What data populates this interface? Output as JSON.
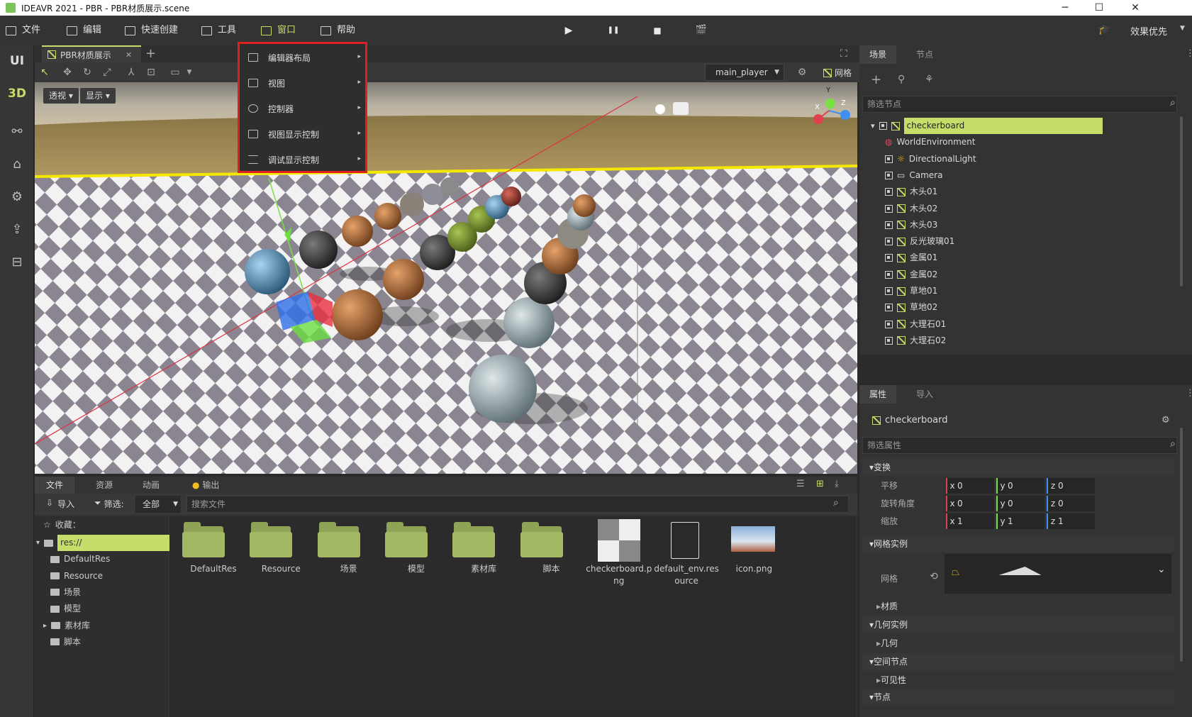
{
  "window": {
    "title": "IDEAVR 2021 - PBR - PBR材质展示.scene",
    "minimize": "─",
    "maximize": "☐",
    "close": "✕"
  },
  "menubar": {
    "items": [
      {
        "label": "文件"
      },
      {
        "label": "编辑"
      },
      {
        "label": "快速创建"
      },
      {
        "label": "工具"
      },
      {
        "label": "窗口"
      },
      {
        "label": "帮助"
      }
    ],
    "play": "▶",
    "pause": "❚❚",
    "stop": "■",
    "movie": "🎬",
    "quality_label": "效果优先"
  },
  "lefttool": {
    "ui": "UI",
    "three_d": "3D"
  },
  "viewport": {
    "tab_label": "PBR材质展示",
    "tab_close": "✕",
    "tab_add": "+",
    "player": "main_player",
    "grid_label": "网格",
    "perspective": "透视",
    "display": "显示",
    "axis_x": "X",
    "axis_y": "Y",
    "axis_z": "Z"
  },
  "window_menu": {
    "items": [
      {
        "label": "编辑器布局"
      },
      {
        "label": "视图"
      },
      {
        "label": "控制器"
      },
      {
        "label": "视图显示控制"
      },
      {
        "label": "调试显示控制"
      }
    ],
    "arrow": "▸"
  },
  "scene_panel": {
    "tabs": [
      "场景",
      "节点"
    ],
    "filter_placeholder": "筛选节点",
    "nodes": [
      {
        "label": "checkerboard",
        "type": "mesh",
        "selected": true
      },
      {
        "label": "WorldEnvironment",
        "type": "env"
      },
      {
        "label": "DirectionalLight",
        "type": "light"
      },
      {
        "label": "Camera",
        "type": "camera"
      },
      {
        "label": "木头01",
        "type": "mesh"
      },
      {
        "label": "木头02",
        "type": "mesh"
      },
      {
        "label": "木头03",
        "type": "mesh"
      },
      {
        "label": "反光玻璃01",
        "type": "mesh"
      },
      {
        "label": "金属01",
        "type": "mesh"
      },
      {
        "label": "金属02",
        "type": "mesh"
      },
      {
        "label": "草地01",
        "type": "mesh"
      },
      {
        "label": "草地02",
        "type": "mesh"
      },
      {
        "label": "大理石01",
        "type": "mesh"
      },
      {
        "label": "大理石02",
        "type": "mesh"
      }
    ]
  },
  "props_panel": {
    "tabs": [
      "属性",
      "导入"
    ],
    "node_name": "checkerboard",
    "filter_placeholder": "筛选属性",
    "transform": "变换",
    "rows": [
      {
        "label": "平移",
        "x": "0",
        "y": "0",
        "z": "0"
      },
      {
        "label": "旋转角度",
        "x": "0",
        "y": "0",
        "z": "0"
      },
      {
        "label": "缩放",
        "x": "1",
        "y": "1",
        "z": "1"
      }
    ],
    "mesh_instance": "网格实例",
    "mesh_label": "网格",
    "material": "材质",
    "geometry_instance": "几何实例",
    "geometry": "几何",
    "spatial": "空间节点",
    "visibility": "可见性",
    "node": "节点",
    "axis_x": "x",
    "axis_y": "y",
    "axis_z": "z",
    "expand": "▾",
    "collapse": "▸",
    "chevron": "⌄"
  },
  "bottom": {
    "tabs": [
      "文件",
      "资源",
      "动画",
      "输出"
    ],
    "import": "导入",
    "filter": "筛选:",
    "filter_value": "全部",
    "search_placeholder": "搜索文件",
    "favorites": "收藏：",
    "tree": [
      {
        "label": "res://",
        "selected": true
      },
      {
        "label": "DefaultRes"
      },
      {
        "label": "Resource"
      },
      {
        "label": "场景"
      },
      {
        "label": "模型"
      },
      {
        "label": "素材库",
        "expandable": true
      },
      {
        "label": "脚本"
      }
    ],
    "files": [
      {
        "label": "DefaultRes",
        "kind": "folder"
      },
      {
        "label": "Resource",
        "kind": "folder"
      },
      {
        "label": "场景",
        "kind": "folder"
      },
      {
        "label": "模型",
        "kind": "folder"
      },
      {
        "label": "素材库",
        "kind": "folder"
      },
      {
        "label": "脚本",
        "kind": "folder"
      },
      {
        "label": "checkerboard.png",
        "kind": "image"
      },
      {
        "label": "default_env.resource",
        "kind": "doc"
      },
      {
        "label": "icon.png",
        "kind": "image"
      }
    ]
  },
  "colors": {
    "accent": "#c6dd6a",
    "highlight_border": "#e02020",
    "panel": "#333333"
  }
}
